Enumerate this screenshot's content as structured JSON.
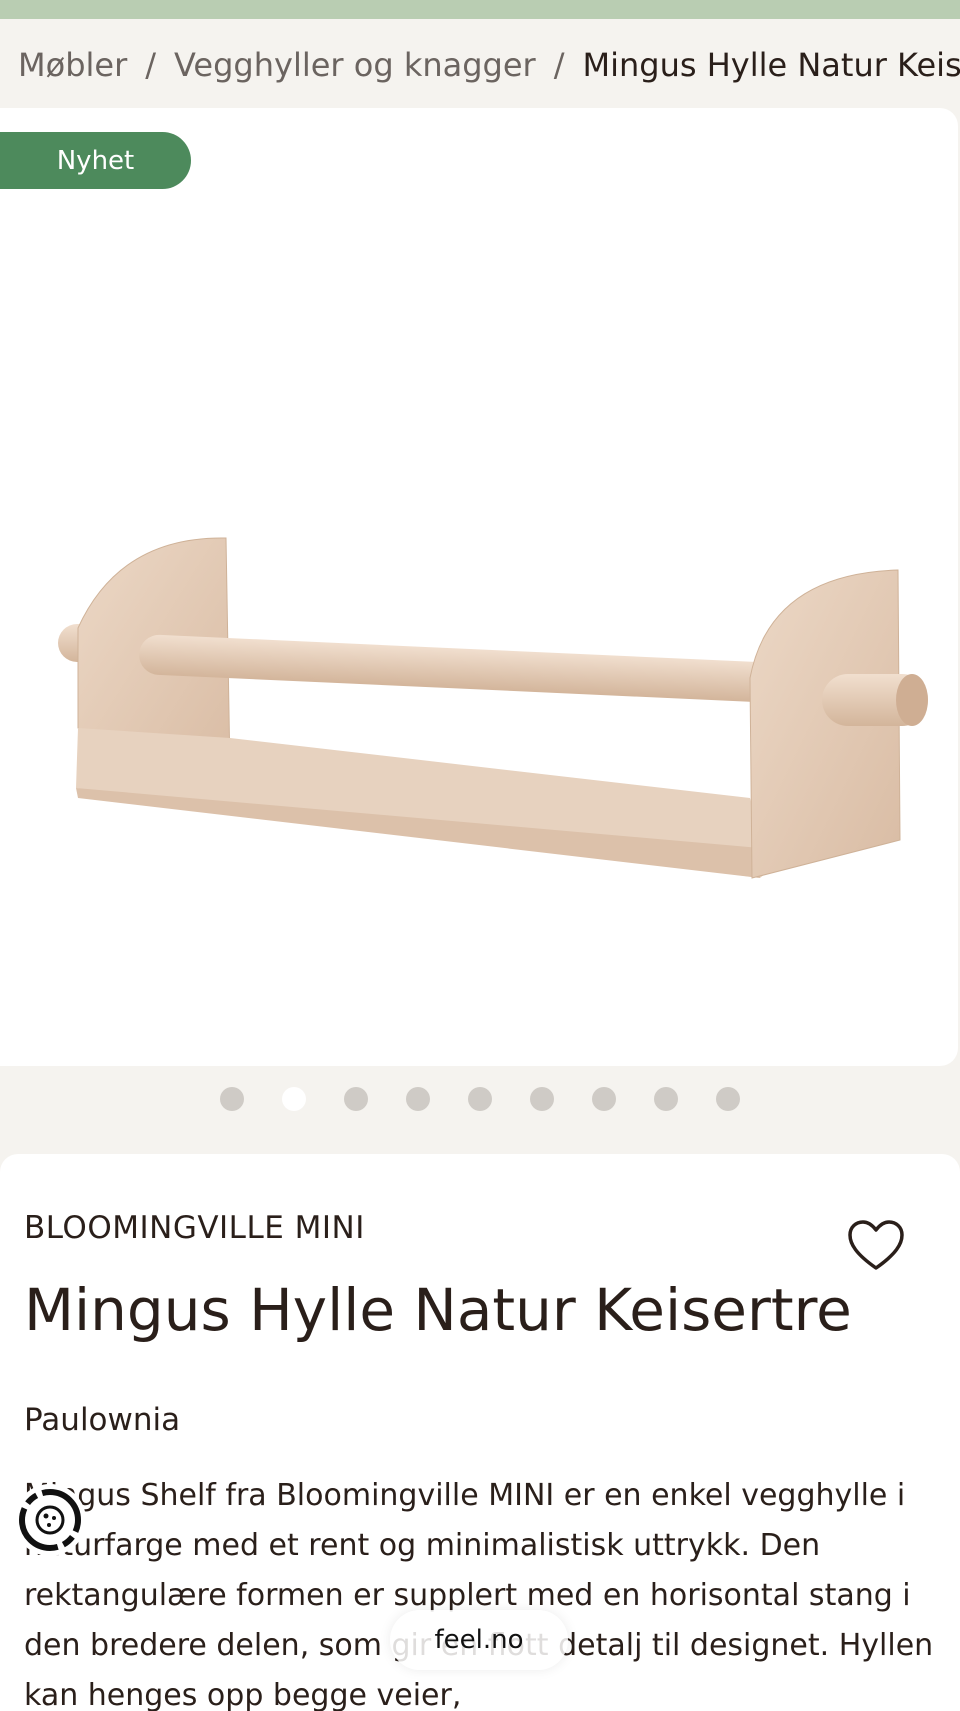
{
  "breadcrumb": {
    "items": [
      "Møbler",
      "Vegghyller og knagger",
      "Mingus Hylle Natur Keisertre"
    ],
    "separator": "/"
  },
  "gallery": {
    "badge": "Nyhet",
    "image_icon": "wooden-wall-shelf-image",
    "slide_count": 9,
    "active_slide": 2
  },
  "product": {
    "brand": "BLOOMINGVILLE MINI",
    "title": "Mingus Hylle Natur Keisertre",
    "material": "Paulownia",
    "description": "Mingus Shelf fra Bloomingville MINI er en enkel vegghylle i naturfarge med et rent og minimalistisk uttrykk. Den rektangulære formen er supplert med en horisontal stang i den bredere delen, som gir en flott detalj til designet. Hyllen kan henges opp begge veier,"
  },
  "browser": {
    "url": "feel.no"
  },
  "colors": {
    "top_strip": "#b9cdb2",
    "badge": "#4d8a5c",
    "page_bg": "#f5f3ef",
    "text": "#2a1f1a",
    "wood": "#e2c9b3"
  }
}
